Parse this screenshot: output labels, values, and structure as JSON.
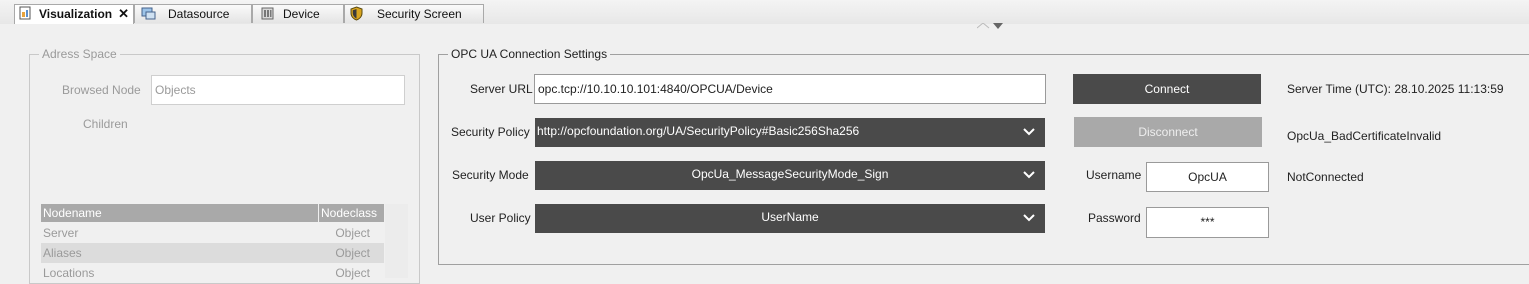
{
  "tabs": [
    {
      "label": "Visualization",
      "icon": "visualization-icon",
      "active": true,
      "closable": true
    },
    {
      "label": "Datasource",
      "icon": "datasource-icon",
      "active": false
    },
    {
      "label": "Device",
      "icon": "device-icon",
      "active": false
    },
    {
      "label": "Security Screen",
      "icon": "security-shield-icon",
      "active": false
    }
  ],
  "address_space": {
    "legend": "Adress Space",
    "browsed_node_label": "Browsed Node",
    "browsed_node_value": "Objects",
    "children_label": "Children",
    "columns": [
      "Nodename",
      "Nodeclass"
    ],
    "rows": [
      {
        "name": "Server",
        "class": "Object"
      },
      {
        "name": "Aliases",
        "class": "Object"
      },
      {
        "name": "Locations",
        "class": "Object"
      }
    ]
  },
  "opcua": {
    "legend": "OPC UA Connection Settings",
    "server_url_label": "Server URL",
    "server_url_value": "opc.tcp://10.10.10.101:4840/OPCUA/Device",
    "security_policy_label": "Security Policy",
    "security_policy_value": "http://opcfoundation.org/UA/SecurityPolicy#Basic256Sha256",
    "security_mode_label": "Security Mode",
    "security_mode_value": "OpcUa_MessageSecurityMode_Sign",
    "user_policy_label": "User Policy",
    "user_policy_value": "UserName",
    "connect_label": "Connect",
    "disconnect_label": "Disconnect",
    "username_label": "Username",
    "username_value": "OpcUA",
    "password_label": "Password",
    "password_value": "***",
    "server_time": "Server Time (UTC): 28.10.2025 11:13:59",
    "status_error": "OpcUa_BadCertificateInvalid",
    "status_connection": "NotConnected"
  },
  "colors": {
    "dark_control": "#4a4a4a",
    "disabled_button": "#a9a9a9",
    "grid_header": "#a9a9a9",
    "muted_text": "#9a9a9a"
  }
}
